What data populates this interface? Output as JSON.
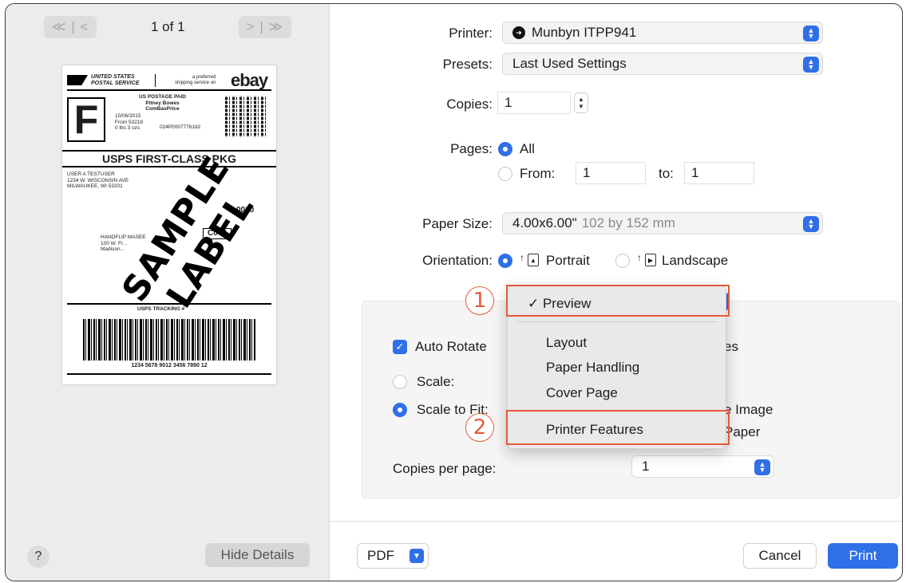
{
  "preview": {
    "first_prev_label": "≪ | <",
    "page_indicator": "1 of 1",
    "next_last_label": "> | ≫",
    "help_label": "?",
    "hide_details_label": "Hide Details",
    "shipping_label": {
      "carrier": "UNITED STATES\nPOSTAL SERVICE",
      "preferred": "a preferred\nshipping service on",
      "ebay": "ebay",
      "service_letter": "F",
      "postage": "US POSTAGE PAID\nPitney Bowes\nComBasPrice",
      "date_info": "10/06/2015\nFrom 53219\n0 lbs 3 ozs",
      "postage_code": "024P0007776182",
      "service_title": "USPS FIRST-CLASS PKG",
      "to_address": "USER A TESTUSER\n1234 W. WISCONSIN AVE\nMILWAUKEE, WI 53201",
      "zero_code": "0000",
      "route_code": "C002",
      "from_address": "HANDFLIP MASEE\n100 W. Fr...\nMadison...",
      "tracking_header": "USPS TRACKING #",
      "tracking_number": "1234 5678 9012 3456 7890 12",
      "watermark": "SAMPLE LABEL"
    }
  },
  "settings": {
    "printer_label": "Printer:",
    "printer_value": "Munbyn ITPP941",
    "presets_label": "Presets:",
    "presets_value": "Last Used Settings",
    "copies_label": "Copies:",
    "copies_value": "1",
    "pages_label": "Pages:",
    "pages_all": "All",
    "pages_from": "From:",
    "from_value": "1",
    "pages_to": "to:",
    "to_value": "1",
    "paper_size_label": "Paper Size:",
    "paper_size_value": "4.00x6.00\"",
    "paper_size_dim": "102 by 152 mm",
    "orientation_label": "Orientation:",
    "orientation_portrait": "Portrait",
    "orientation_landscape": "Landscape"
  },
  "preview_panel": {
    "auto_rotate": "Auto Rotate",
    "auto_rotate_tail": "es",
    "scale": "Scale:",
    "scale_to_fit": "Scale to Fit:",
    "image_tail": "e Image",
    "paper_tail": "Paper",
    "copies_per_page_label": "Copies per page:",
    "copies_per_page_value": "1"
  },
  "menu": {
    "selected": "✓ Preview",
    "items": [
      "Layout",
      "Paper Handling",
      "Cover Page",
      "Printer Features"
    ]
  },
  "callouts": [
    "1",
    "2"
  ],
  "buttons": {
    "pdf": "PDF",
    "cancel": "Cancel",
    "print": "Print"
  },
  "colors": {
    "accent": "#2f6fe8",
    "callout": "#e65a36"
  }
}
